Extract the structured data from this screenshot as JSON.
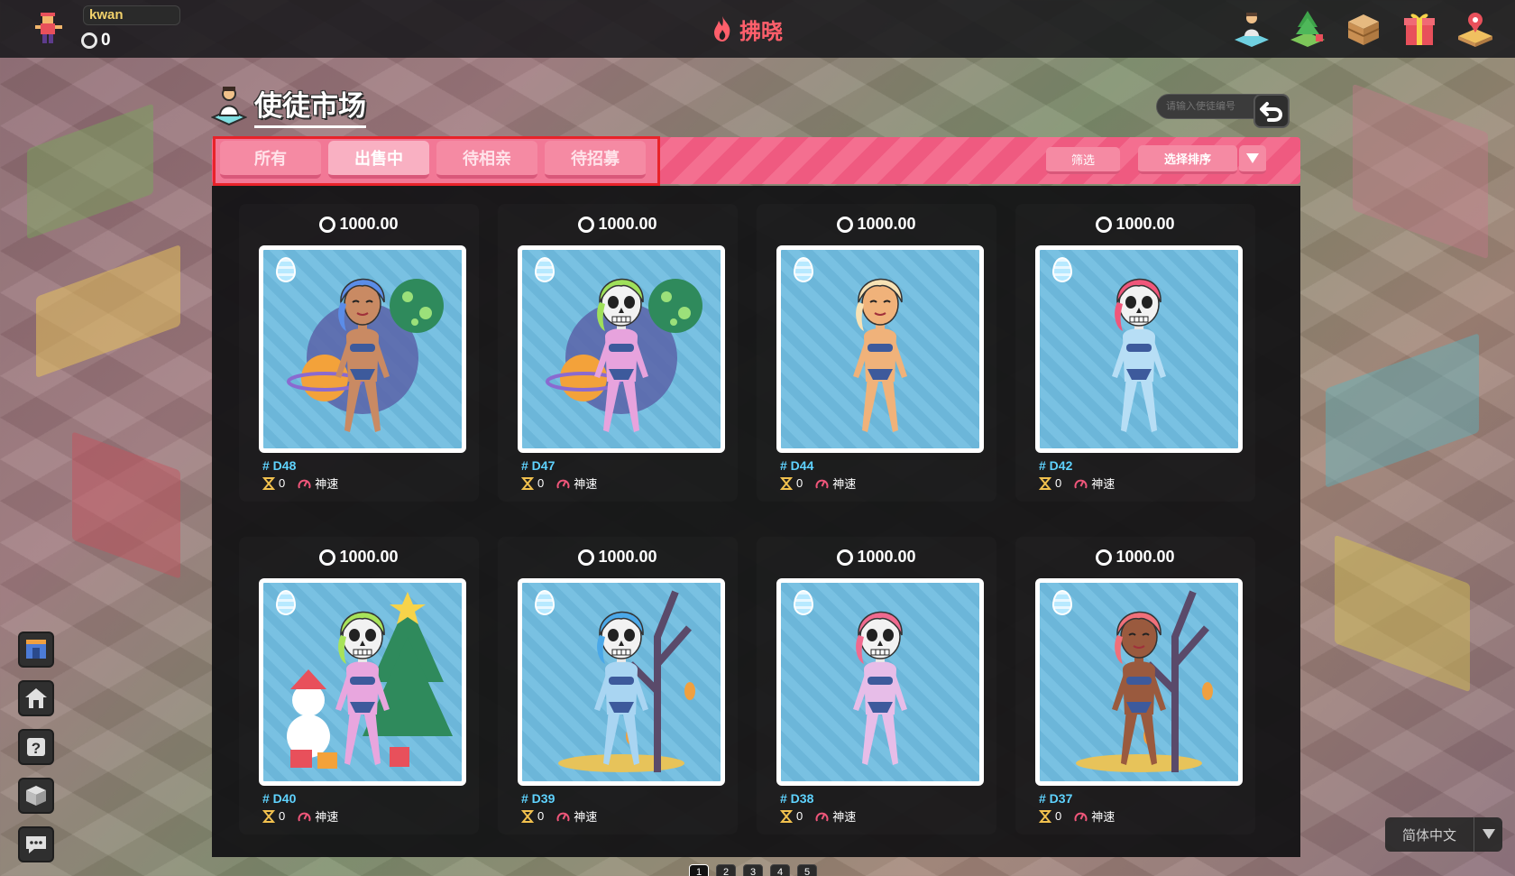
{
  "user": {
    "name": "kwan",
    "balance": "0"
  },
  "header": {
    "title": "拂晓",
    "icons": [
      "character-icon",
      "tree-icon",
      "chest-icon",
      "gift-icon",
      "land-icon"
    ]
  },
  "market": {
    "title": "使徒市场",
    "search_placeholder": "请输入使徒编号",
    "tabs": [
      {
        "label": "所有",
        "active": false
      },
      {
        "label": "出售中",
        "active": true
      },
      {
        "label": "待相亲",
        "active": false
      },
      {
        "label": "待招募",
        "active": false
      }
    ],
    "filter_label": "筛选",
    "sort_label": "选择排序"
  },
  "cards": [
    {
      "price": "1000.00",
      "id": "# D48",
      "gen": "0",
      "speed": "神速",
      "hair": "#5b8de8",
      "skin": "#c98a63",
      "skull": false,
      "bg_deco": "planets"
    },
    {
      "price": "1000.00",
      "id": "# D47",
      "gen": "0",
      "speed": "神速",
      "hair": "#9fe05a",
      "skin": "#e7a3dd",
      "skull": true,
      "bg_deco": "planets"
    },
    {
      "price": "1000.00",
      "id": "# D44",
      "gen": "0",
      "speed": "神速",
      "hair": "#f7e2b5",
      "skin": "#f0b27a",
      "skull": false,
      "bg_deco": "none"
    },
    {
      "price": "1000.00",
      "id": "# D42",
      "gen": "0",
      "speed": "神速",
      "hair": "#f0567a",
      "skin": "#b7def5",
      "skull": true,
      "bg_deco": "none"
    },
    {
      "price": "1000.00",
      "id": "# D40",
      "gen": "0",
      "speed": "神速",
      "hair": "#a8e35a",
      "skin": "#e8a6de",
      "skull": true,
      "bg_deco": "christmas"
    },
    {
      "price": "1000.00",
      "id": "# D39",
      "gen": "0",
      "speed": "神速",
      "hair": "#4ba8e8",
      "skin": "#a9d5f2",
      "skull": true,
      "bg_deco": "tree"
    },
    {
      "price": "1000.00",
      "id": "# D38",
      "gen": "0",
      "speed": "神速",
      "hair": "#f06a8f",
      "skin": "#e7bde8",
      "skull": true,
      "bg_deco": "none"
    },
    {
      "price": "1000.00",
      "id": "# D37",
      "gen": "0",
      "speed": "神速",
      "hair": "#f0707a",
      "skin": "#9a5a3e",
      "skull": false,
      "bg_deco": "tree"
    }
  ],
  "pagination": [
    "1",
    "2",
    "3",
    "4",
    "5"
  ],
  "language": "简体中文"
}
